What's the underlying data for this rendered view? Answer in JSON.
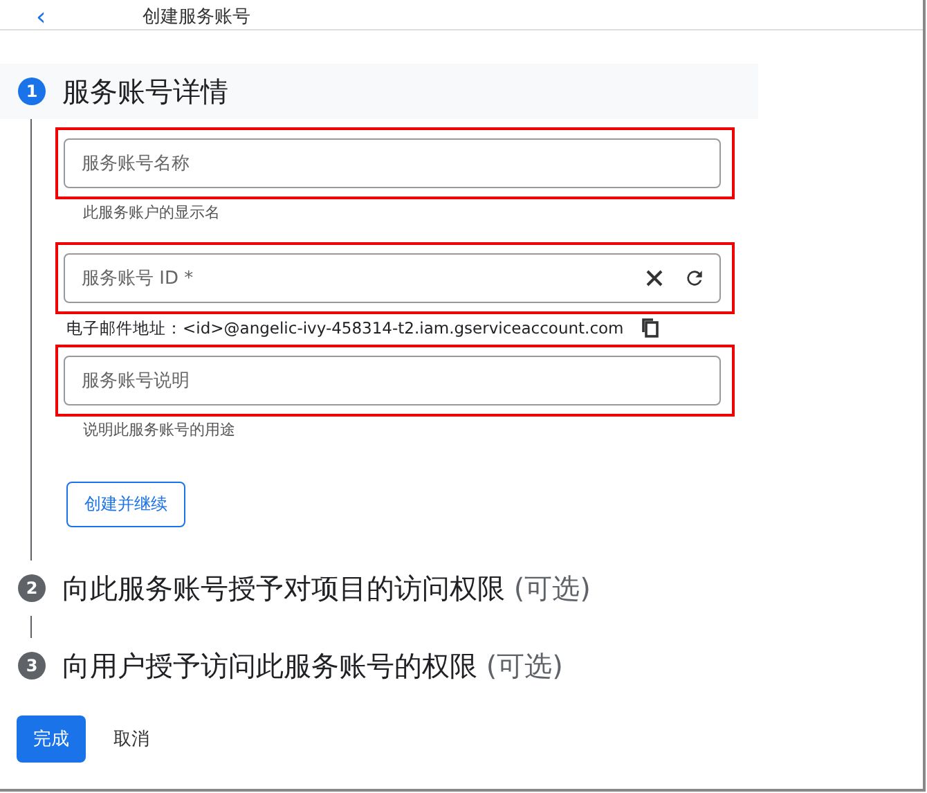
{
  "header": {
    "back": "‹",
    "title": "创建服务账号"
  },
  "steps": [
    {
      "number": "1",
      "title": "服务账号详情",
      "active": true
    },
    {
      "number": "2",
      "title": "向此服务账号授予对项目的访问权限",
      "optional": "(可选)",
      "active": false
    },
    {
      "number": "3",
      "title": "向用户授予访问此服务账号的权限",
      "optional": "(可选)",
      "active": false
    }
  ],
  "fields": [
    {
      "placeholder": "服务账号名称",
      "hint": "此服务账户的显示名",
      "highlighted": true,
      "actions": false
    },
    {
      "placeholder": "服务账号 ID *",
      "highlighted": true,
      "actions": true,
      "email": "电子邮件地址：<id>@angelic-ivy-458314-t2.iam.gserviceaccount.com"
    },
    {
      "placeholder": "服务账号说明",
      "hint": "说明此服务账号的用途",
      "highlighted": true,
      "actions": false
    }
  ],
  "continue_button": "创建并继续",
  "done_button": "完成",
  "cancel_button": "取消"
}
